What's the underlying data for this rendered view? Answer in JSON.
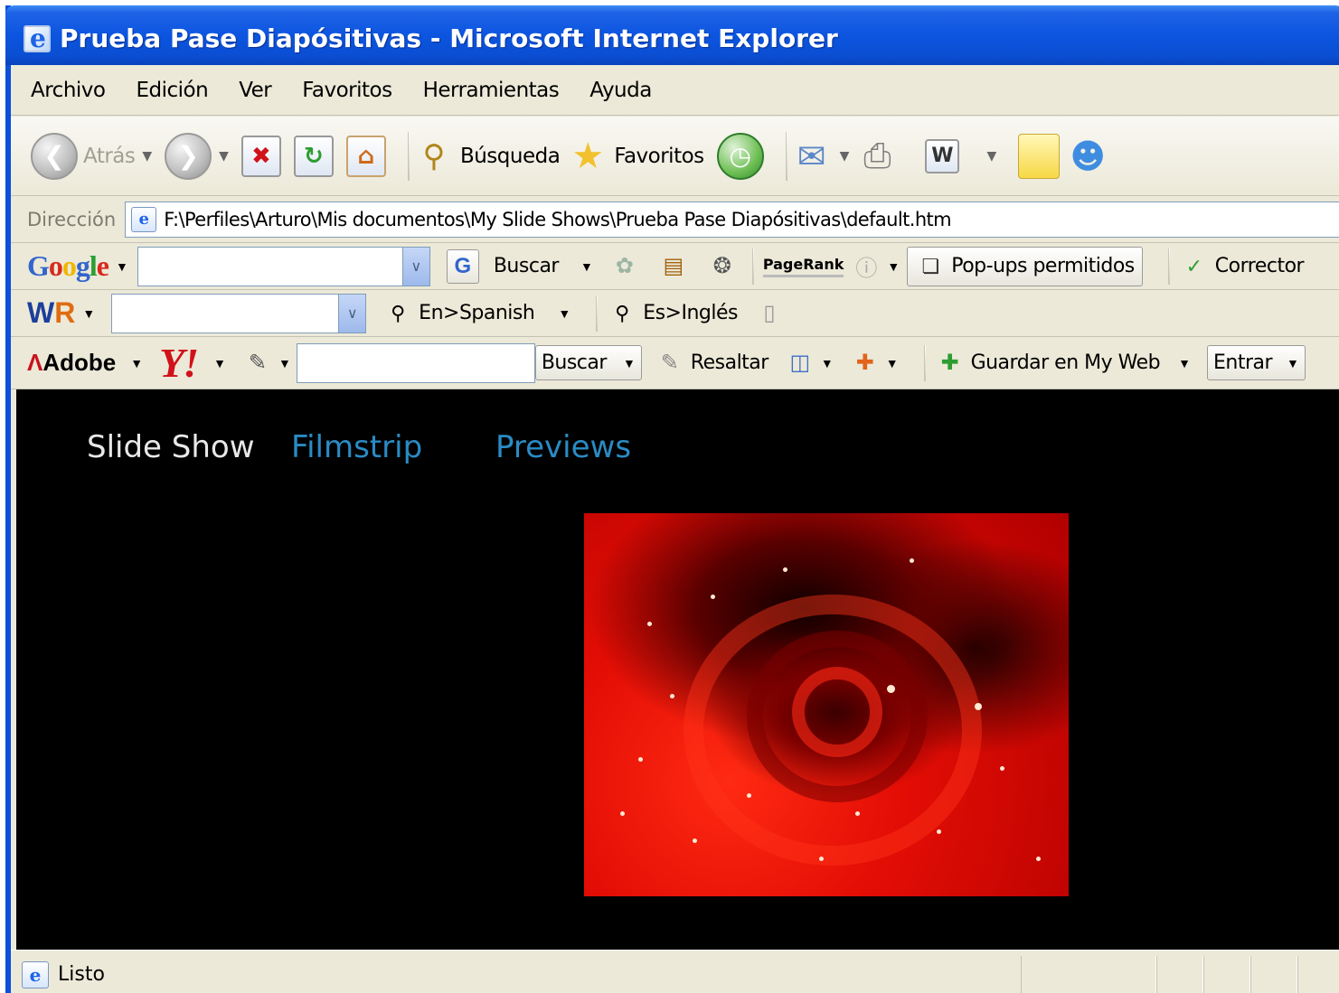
{
  "window": {
    "title": "Prueba Pase Diapósitivas - Microsoft Internet Explorer"
  },
  "menu": [
    "Archivo",
    "Edición",
    "Ver",
    "Favoritos",
    "Herramientas",
    "Ayuda"
  ],
  "toolbar": {
    "back_label": "Atrás",
    "search_label": "Búsqueda",
    "favorites_label": "Favoritos"
  },
  "address": {
    "label": "Dirección",
    "url": "F:\\Perfiles\\Arturo\\Mis documentos\\My Slide Shows\\Prueba  Pase Diapósitivas\\default.htm"
  },
  "google_bar": {
    "search_value": "",
    "search_label": "Buscar",
    "pagerank_label": "PageRank",
    "popups_label": "Pop-ups permitidos",
    "spell_label": "Corrector"
  },
  "wr_bar": {
    "search_value": "",
    "en_spanish_label": "En>Spanish",
    "es_ingles_label": "Es>Inglés"
  },
  "adobe_bar": {
    "adobe_label": "Adobe",
    "yahoo_label": "Y!",
    "search_value": "",
    "search_label": "Buscar",
    "highlight_label": "Resaltar",
    "save_label": "Guardar en My Web",
    "enter_label": "Entrar"
  },
  "slideshow": {
    "tabs": [
      "Slide Show",
      "Filmstrip",
      "Previews"
    ],
    "active_tab": "Slide Show"
  },
  "status": {
    "text": "Listo"
  },
  "colors": {
    "titlebar_blue": "#0c55e0",
    "chrome_beige": "#ece9d8",
    "content_bg": "#000000",
    "tab_active": "#e8e8e8",
    "tab_inactive": "#2a8bc4"
  }
}
